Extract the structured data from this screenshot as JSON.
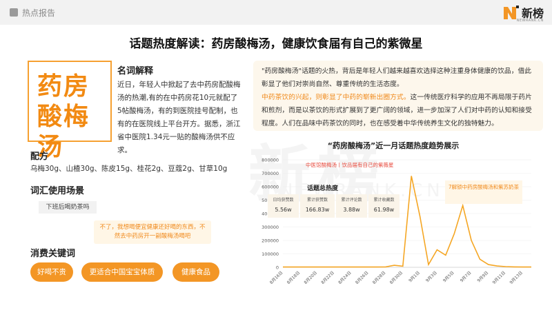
{
  "header": {
    "section": "热点报告",
    "brand": "新榜",
    "brand_sub": "NEWRANK.CN"
  },
  "title": "话题热度解读：药房酸梅汤，健康饮食届有自己的紫微星",
  "logo_text": "药房\n酸梅汤",
  "definition": {
    "heading": "名词解释",
    "body": "近日，年轻人中掀起了去中药房配酸梅汤的热潮,有的在中药房花10元就配了5帖酸梅汤，有的到医院挂号配制，也有的在医院线上平台开方。据悉，浙江省中医院1.34元一贴的酸梅汤供不应求。"
  },
  "recipe": {
    "heading": "配方",
    "body": "乌梅30g、山楂30g、陈皮15g、桂花2g、豆蔻2g、甘草10g"
  },
  "scenario": {
    "heading": "词汇使用场景",
    "tag": "下班后喝奶茶吗",
    "reply": "不了，我想喝便宜健康还好喝的东西，不然去中药房开一副酸梅汤喝吧"
  },
  "keywords": {
    "heading": "消费关键词",
    "items": [
      "好喝不贵",
      "更适合中国宝宝体质",
      "健康食品"
    ]
  },
  "interpretation": {
    "p1": "\"药房酸梅汤\"话题的火热，背后是年轻人们越来越喜欢选择这种注重身体健康的饮品，借此彰显了他们对崇尚自然、尊重传统的生活态度。",
    "highlight": "中药茶饮的兴起，则彰显了中药的崭新出圈方式。",
    "p2": "这一传统医疗科学的应用不再局限于药片和煎剂，而是以茶饮的形式扩展到了更广阔的领域，进一步加深了人们对中药的认知和接受程度。人们在品味中药茶饮的同时，也在感受着中华传统养生文化的独特魅力。"
  },
  "stats": {
    "heading": "话题总热度",
    "items": [
      {
        "label": "日均获赞数",
        "value": "5.56w"
      },
      {
        "label": "累计获赞数",
        "value": "166.83w"
      },
      {
        "label": "累计评论数",
        "value": "3.88w"
      },
      {
        "label": "累计收藏数",
        "value": "61.98w"
      }
    ]
  },
  "annotations": {
    "red": "中医馆酸梅汤丨饮品届有自己的紫薇星",
    "orange": "7解锁中药房酸梅汤和紫苏奶茶"
  },
  "colors": {
    "accent": "#f39625",
    "line": "#f5a623",
    "red": "#e84a3d"
  },
  "chart_data": {
    "type": "line",
    "title": "“药房酸梅汤”近一月话题热度趋势展示",
    "ylim": [
      0,
      800000
    ],
    "yticks": [
      0,
      100000,
      200000,
      300000,
      400000,
      500000,
      600000,
      700000,
      800000
    ],
    "xticks": [
      "8月16日",
      "8月18日",
      "8月20日",
      "8月22日",
      "8月24日",
      "8月26日",
      "8月28日",
      "8月30日",
      "9月1日",
      "9月3日",
      "9月5日",
      "9月7日",
      "9月9日",
      "9月11日",
      "9月13日"
    ],
    "x": [
      "8月16日",
      "8月17日",
      "8月18日",
      "8月19日",
      "8月20日",
      "8月21日",
      "8月22日",
      "8月23日",
      "8月24日",
      "8月25日",
      "8月26日",
      "8月27日",
      "8月28日",
      "8月29日",
      "8月30日",
      "8月31日",
      "9月1日",
      "9月2日",
      "9月3日",
      "9月4日",
      "9月5日",
      "9月6日",
      "9月7日",
      "9月8日",
      "9月9日",
      "9月10日",
      "9月11日",
      "9月12日",
      "9月13日",
      "9月14日"
    ],
    "series": [
      {
        "values": [
          2000,
          2000,
          2000,
          2000,
          2000,
          2000,
          2000,
          2000,
          2000,
          2000,
          2000,
          2000,
          3000,
          15000,
          8000,
          680000,
          380000,
          20000,
          130000,
          90000,
          250000,
          460000,
          200000,
          60000,
          20000,
          10000,
          5000,
          3000,
          2000,
          2000
        ]
      }
    ]
  }
}
